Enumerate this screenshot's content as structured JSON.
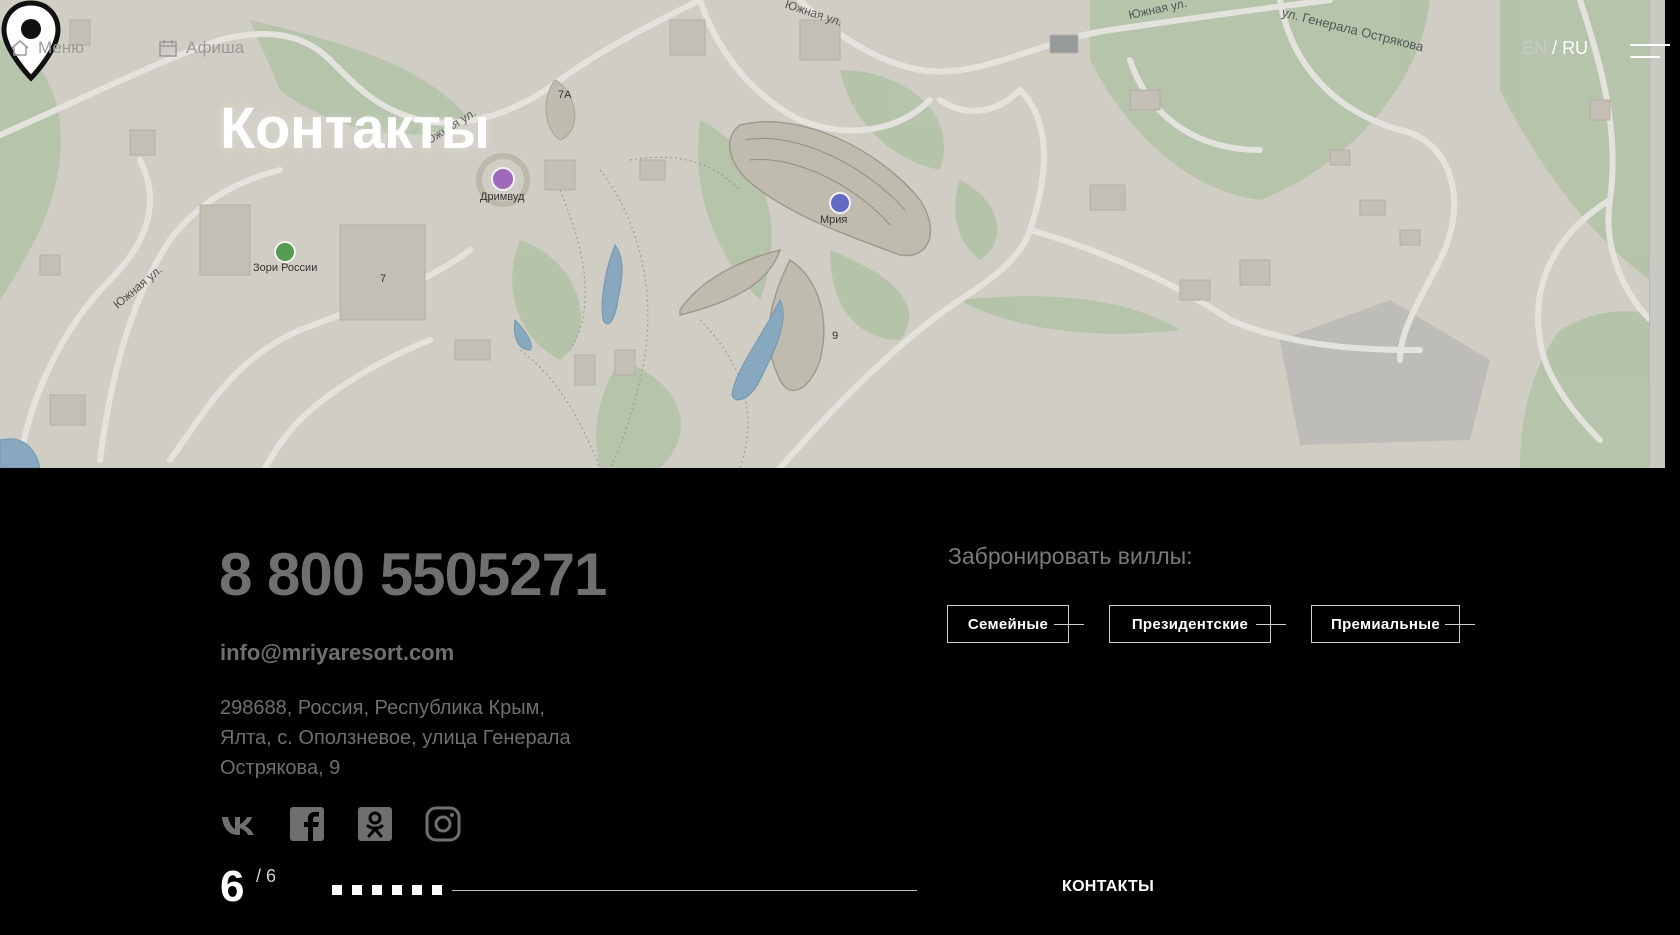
{
  "header": {
    "menu_label": "Меню",
    "afisha_label": "Афиша",
    "lang_en": "EN",
    "lang_sep": "/",
    "lang_ru": "RU"
  },
  "page_title": "Контакты",
  "map": {
    "labels": {
      "road_1": "Южная ул.",
      "road_2": "Южная ул.",
      "road_3": "Южная ул.",
      "road_4": "ул. Генерала Острякова",
      "road_5": "Южная ул.",
      "poi_dreamwood": "Дримвуд",
      "poi_zori": "Зори России",
      "poi_mriya": "Мрия",
      "bld_7a": "7А",
      "bld_7": "7",
      "bld_9": "9"
    }
  },
  "contacts": {
    "phone": "8 800 5505271",
    "email": "info@mriyaresort.com",
    "address_line1": "298688, Россия, Республика Крым,",
    "address_line2": "Ялта, с. Оползневое, улица Генерала",
    "address_line3": "Острякова, 9"
  },
  "booking": {
    "label": "Забронировать виллы:",
    "buttons": [
      "Семейные",
      "Президентские",
      "Премиальные"
    ]
  },
  "pagination": {
    "current": "6",
    "total": "/ 6",
    "section": "КОНТАКТЫ"
  },
  "colors": {
    "background": "#000000",
    "map_base": "#dcd9cf",
    "map_green": "#b9cdb0",
    "muted_text": "#6f6f6f"
  }
}
